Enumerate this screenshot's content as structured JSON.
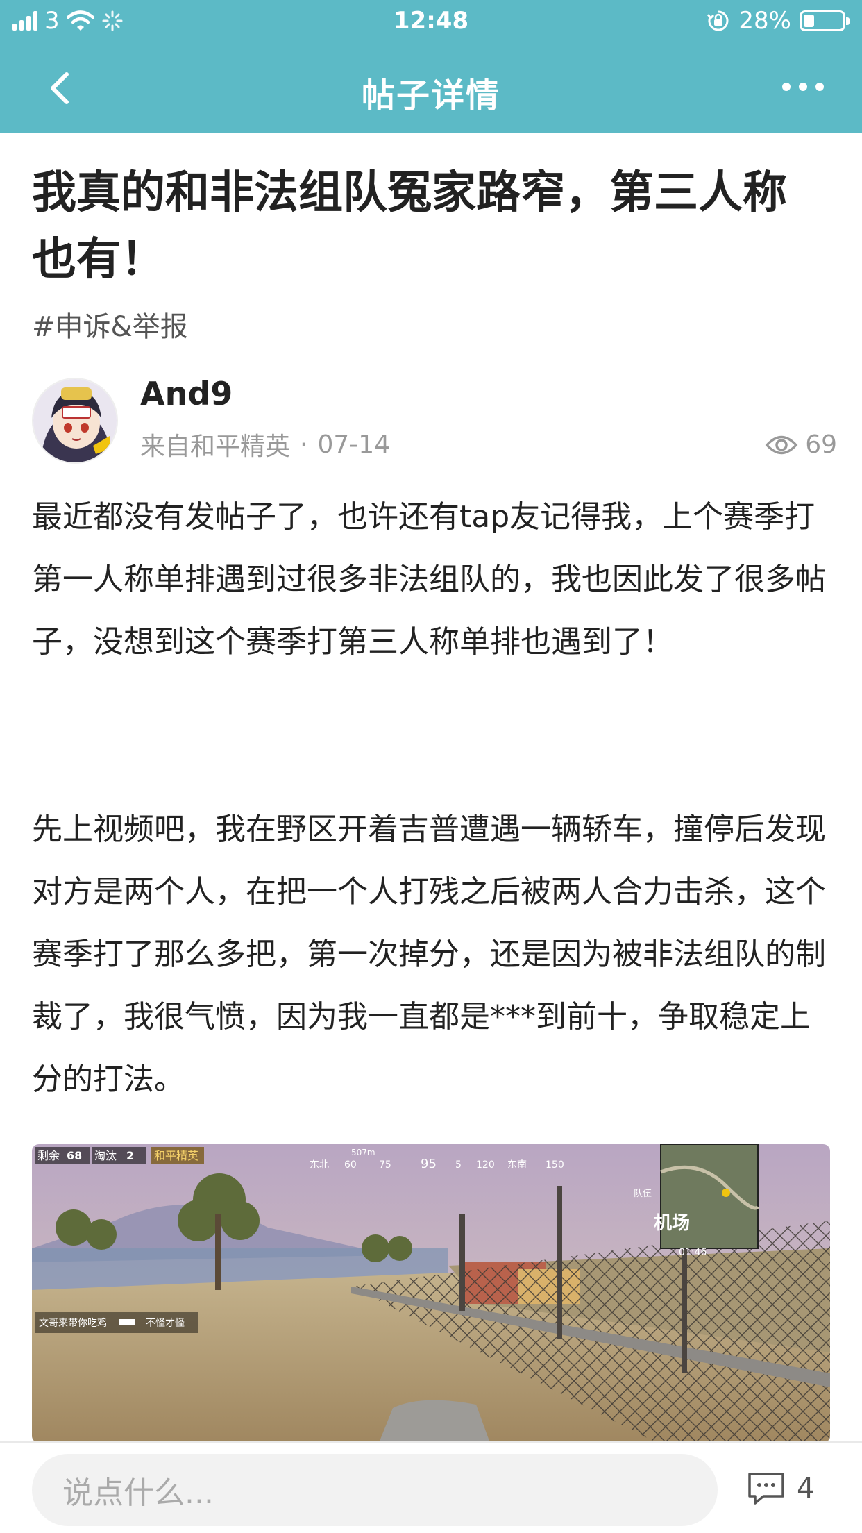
{
  "status_bar": {
    "carrier": "3",
    "time": "12:48",
    "battery_percent_text": "28%",
    "battery_level": 0.28
  },
  "nav": {
    "title": "帖子详情"
  },
  "post": {
    "title": "我真的和非法组队冤家路窄，第三人称也有！",
    "topic_tag": "#申诉&举报",
    "author": {
      "name": "And9",
      "source": "来自和平精英",
      "separator": "·",
      "date": "07-14"
    },
    "views": "69",
    "paragraphs": [
      "最近都没有发帖子了，也许还有tap友记得我，上个赛季打第一人称单排遇到过很多非法组队的，我也因此发了很多帖子，没想到这个赛季打第三人称单排也遇到了！",
      "先上视频吧，我在野区开着吉普遭遇一辆轿车，撞停后发现对方是两个人，在把一个人打残之后被两人合力击杀，这个赛季打了那么多把，第一次掉分，还是因为被非法组队的制裁了，我很气愤，因为我一直都是***到前十，争取稳定上分的打法。"
    ],
    "video_hud": {
      "remaining_label": "剩余",
      "remaining": "68",
      "eliminated_label": "淘汰",
      "eliminated": "2",
      "game_logo": "和平精英",
      "distance": "507m",
      "compass": [
        "东北",
        "60",
        "75",
        "95",
        "5",
        "120",
        "东南",
        "150"
      ],
      "team_label": "队伍",
      "map_label": "机场",
      "timer": "01:46",
      "kill_feed_killer": "文哥来带你吃鸡",
      "kill_feed_victim": "不怪才怪"
    }
  },
  "bottom_bar": {
    "comment_placeholder": "说点什么...",
    "comment_count": "4"
  },
  "colors": {
    "header": "#5cbac6",
    "text": "#222222",
    "meta": "#999999",
    "input_bg": "#f2f2f2"
  },
  "icons": {
    "back": "chevron-left-icon",
    "more": "more-dots-icon",
    "views": "eye-icon",
    "comment": "comment-bubble-icon",
    "wifi": "wifi-icon",
    "rotation_lock": "rotation-lock-icon",
    "battery": "battery-icon"
  }
}
